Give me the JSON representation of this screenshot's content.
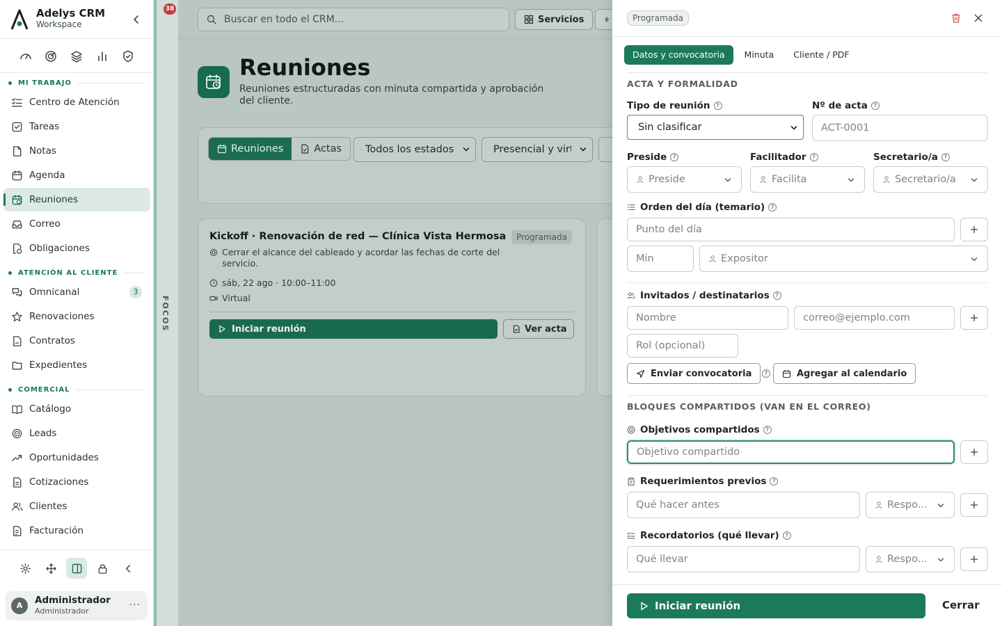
{
  "sidebar": {
    "brand_name": "Adelys CRM",
    "brand_sub": "Workspace",
    "sections": {
      "mi_trabajo": "MI TRABAJO",
      "atencion": "ATENCIÓN AL CLIENTE",
      "comercial": "COMERCIAL"
    },
    "items": {
      "centro": "Centro de Atención",
      "tareas": "Tareas",
      "notas": "Notas",
      "agenda": "Agenda",
      "reuniones": "Reuniones",
      "correo": "Correo",
      "obligaciones": "Obligaciones",
      "omnicanal": "Omnicanal",
      "omnicanal_badge": "3",
      "renovaciones": "Renovaciones",
      "contratos": "Contratos",
      "expedientes": "Expedientes",
      "catalogo": "Catálogo",
      "leads": "Leads",
      "oportunidades": "Oportunidades",
      "cotizaciones": "Cotizaciones",
      "clientes": "Clientes",
      "facturacion": "Facturación"
    },
    "user": {
      "initial": "A",
      "name": "Administrador",
      "role": "Administrador",
      "more": "···"
    }
  },
  "focus_rail": {
    "notifications": "38",
    "label": "FOCOS"
  },
  "main": {
    "search_placeholder": "Buscar en todo el CRM...",
    "servicios_label": "Servicios",
    "title": "Reuniones",
    "subtitle": "Reuniones estructuradas con minuta compartida y aprobación del cliente.",
    "seg_reuniones": "Reuniones",
    "seg_actas": "Actas",
    "filter_status": "Todos los estados",
    "filter_mode": "Presencial y virtual",
    "card": {
      "title": "Kickoff · Renovación de red — Clínica Vista Hermosa",
      "status": "Programada",
      "objective": "Cerrar el alcance del cableado y acordar las fechas de corte del servicio.",
      "date": "sáb, 22 ago · 10:00–11:00",
      "mode": "Virtual",
      "start_label": "Iniciar reunión",
      "acta_label": "Ver acta"
    }
  },
  "drawer": {
    "status": "Programada",
    "tabs": [
      "Datos y convocatoria",
      "Minuta",
      "Cliente / PDF"
    ],
    "section_acta": "ACTA Y FORMALIDAD",
    "tipo_label": "Tipo de reunión",
    "tipo_value": "Sin clasificar",
    "acta_label": "Nº de acta",
    "acta_placeholder": "ACT-0001",
    "preside_label": "Preside",
    "preside_placeholder": "Preside",
    "facilitador_label": "Facilitador",
    "facilitador_placeholder": "Facilita",
    "secretario_label": "Secretario/a",
    "secretario_placeholder": "Secretario/a",
    "orden_label": "Orden del día (temario)",
    "punto_placeholder": "Punto del día",
    "min_placeholder": "Min",
    "expositor_placeholder": "Expositor",
    "invitados_label": "Invitados / destinatarios",
    "nombre_placeholder": "Nombre",
    "correo_placeholder": "correo@ejemplo.com",
    "rol_placeholder": "Rol (opcional)",
    "enviar_label": "Enviar convocatoria",
    "calendario_label": "Agregar al calendario",
    "section_bloques": "BLOQUES COMPARTIDOS (VAN EN EL CORREO)",
    "objetivos_label": "Objetivos compartidos",
    "objetivo_placeholder": "Objetivo compartido",
    "requerimientos_label": "Requerimientos previos",
    "requerimiento_placeholder": "Qué hacer antes",
    "responsable_placeholder": "Respo...",
    "recordatorios_label": "Recordatorios (qué llevar)",
    "recordatorio_placeholder": "Qué llevar",
    "start_label": "Iniciar reunión",
    "close_label": "Cerrar",
    "help_glyph": "?"
  },
  "colors": {
    "accent": "#1b7a57",
    "danger": "#d9534f"
  }
}
